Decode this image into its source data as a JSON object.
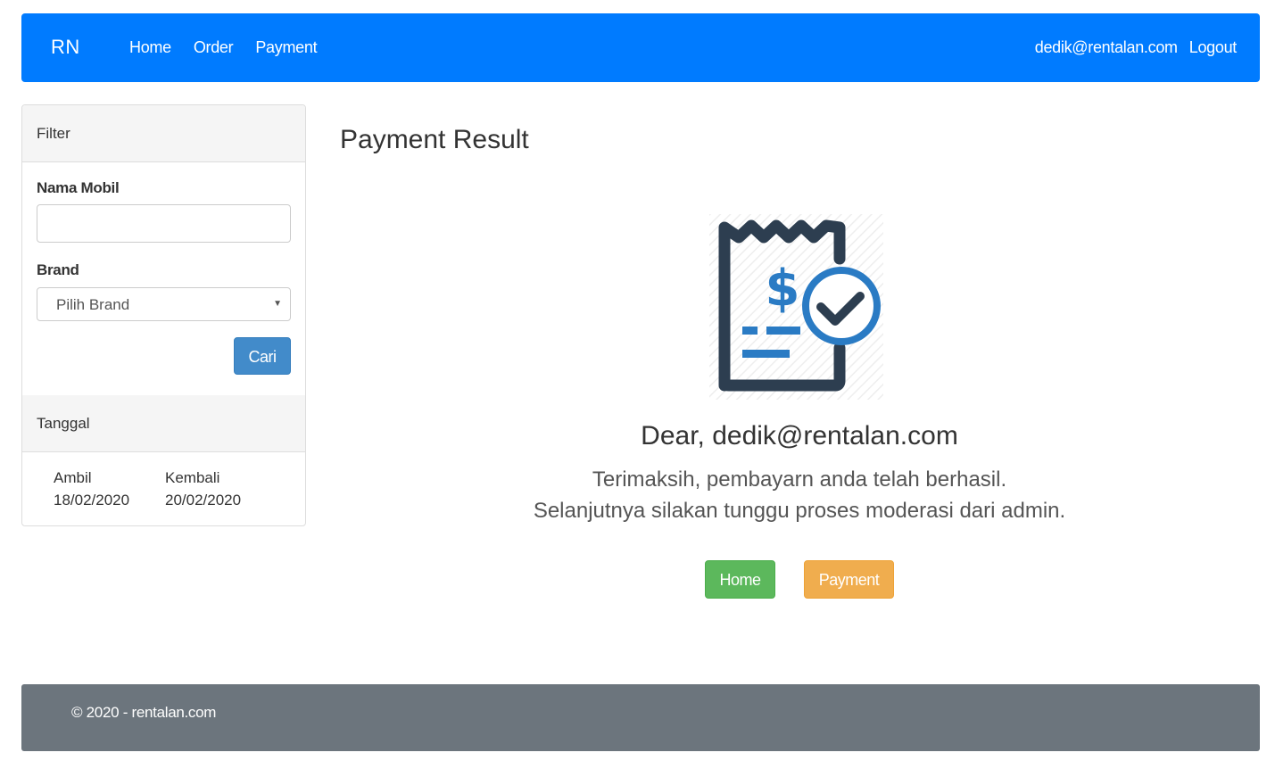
{
  "navbar": {
    "brand": "RN",
    "links": [
      "Home",
      "Order",
      "Payment"
    ],
    "user_email": "dedik@rentalan.com",
    "logout_label": "Logout",
    "color": "#007bff"
  },
  "sidebar": {
    "filter_heading": "Filter",
    "nama_mobil_label": "Nama Mobil",
    "nama_mobil_value": "",
    "brand_label": "Brand",
    "brand_selected": "Pilih Brand",
    "search_button": "Cari",
    "tanggal_heading": "Tanggal",
    "ambil_label": "Ambil",
    "ambil_date": "18/02/2020",
    "kembali_label": "Kembali",
    "kembali_date": "20/02/2020"
  },
  "main": {
    "title": "Payment Result",
    "icon": "receipt-check-icon",
    "dear": "Dear, dedik@rentalan.com",
    "message_line1": "Terimaksih, pembayarn anda telah berhasil.",
    "message_line2": "Selanjutnya silakan tunggu proses moderasi dari admin.",
    "home_button": "Home",
    "payment_button": "Payment"
  },
  "footer": {
    "text": "© 2020 - rentalan.com"
  },
  "colors": {
    "success": "#5cb85c",
    "warning": "#f0ad4e",
    "primary": "#428bca",
    "footer_bg": "#6c757d",
    "icon_dark": "#2d3e50",
    "icon_blue": "#2a7bc4"
  }
}
